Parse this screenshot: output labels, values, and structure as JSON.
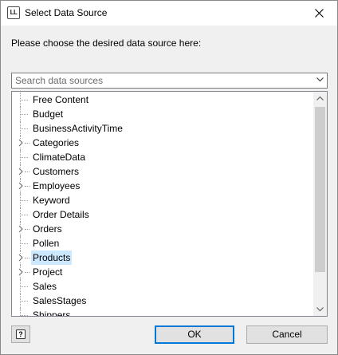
{
  "window": {
    "icon_text": "LL",
    "title": "Select Data Source"
  },
  "prompt": "Please choose the desired data source here:",
  "search": {
    "placeholder": "Search data sources",
    "value": ""
  },
  "tree": {
    "items": [
      {
        "label": "Free Content",
        "expandable": false,
        "selected": false
      },
      {
        "label": "Budget",
        "expandable": false,
        "selected": false
      },
      {
        "label": "BusinessActivityTime",
        "expandable": false,
        "selected": false
      },
      {
        "label": "Categories",
        "expandable": true,
        "selected": false
      },
      {
        "label": "ClimateData",
        "expandable": false,
        "selected": false
      },
      {
        "label": "Customers",
        "expandable": true,
        "selected": false
      },
      {
        "label": "Employees",
        "expandable": true,
        "selected": false
      },
      {
        "label": "Keyword",
        "expandable": false,
        "selected": false
      },
      {
        "label": "Order Details",
        "expandable": false,
        "selected": false
      },
      {
        "label": "Orders",
        "expandable": true,
        "selected": false
      },
      {
        "label": "Pollen",
        "expandable": false,
        "selected": false
      },
      {
        "label": "Products",
        "expandable": true,
        "selected": true
      },
      {
        "label": "Project",
        "expandable": true,
        "selected": false
      },
      {
        "label": "Sales",
        "expandable": false,
        "selected": false
      },
      {
        "label": "SalesStages",
        "expandable": false,
        "selected": false
      },
      {
        "label": "Shippers",
        "expandable": false,
        "selected": false
      }
    ]
  },
  "buttons": {
    "ok": "OK",
    "cancel": "Cancel",
    "help_icon_text": "?"
  },
  "colors": {
    "selection": "#cce8ff",
    "default_button_border": "#0078d7"
  }
}
